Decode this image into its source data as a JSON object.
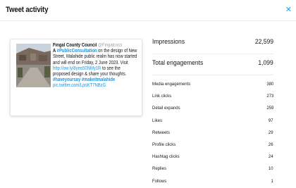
{
  "header": {
    "title": "Tweet activity",
    "close_icon": "close-icon"
  },
  "tweet": {
    "author": "Fingal County Council",
    "handle": "@Fingalcoco",
    "lines": [
      {
        "text": "A #PublicConsultation on the design of New",
        "style": "normal"
      },
      {
        "text": "Street, Malahide public realm has now started",
        "style": "normal"
      },
      {
        "text": "and will end on Friday, 2 June 2023. Visit",
        "style": "normal"
      },
      {
        "text": "http://ow.ly/8yeo50NMy1R  to see the",
        "style": "link-start"
      },
      {
        "text": "proposed design & share your thoughts.",
        "style": "normal"
      },
      {
        "text": "#haveyoursay #makeitmalahide",
        "style": "tags"
      },
      {
        "text": "pic.twitter.com/LpoKT7NBzG",
        "style": "link"
      }
    ],
    "link_text": "http://ow.ly/8yeo50NMy1R"
  },
  "stats": {
    "impressions": {
      "label": "Impressions",
      "value": "22,599"
    },
    "total_engagements": {
      "label": "Total engagements",
      "value": "1,099"
    },
    "breakdown": [
      {
        "label": "Media engagements",
        "value": "380"
      },
      {
        "label": "Link clicks",
        "value": "273"
      },
      {
        "label": "Detail expands",
        "value": "259"
      },
      {
        "label": "Likes",
        "value": "97"
      },
      {
        "label": "Retweets",
        "value": "29"
      },
      {
        "label": "Profile clicks",
        "value": "26"
      },
      {
        "label": "Hashtag clicks",
        "value": "24"
      },
      {
        "label": "Replies",
        "value": "10"
      },
      {
        "label": "Follows",
        "value": "1"
      }
    ]
  }
}
